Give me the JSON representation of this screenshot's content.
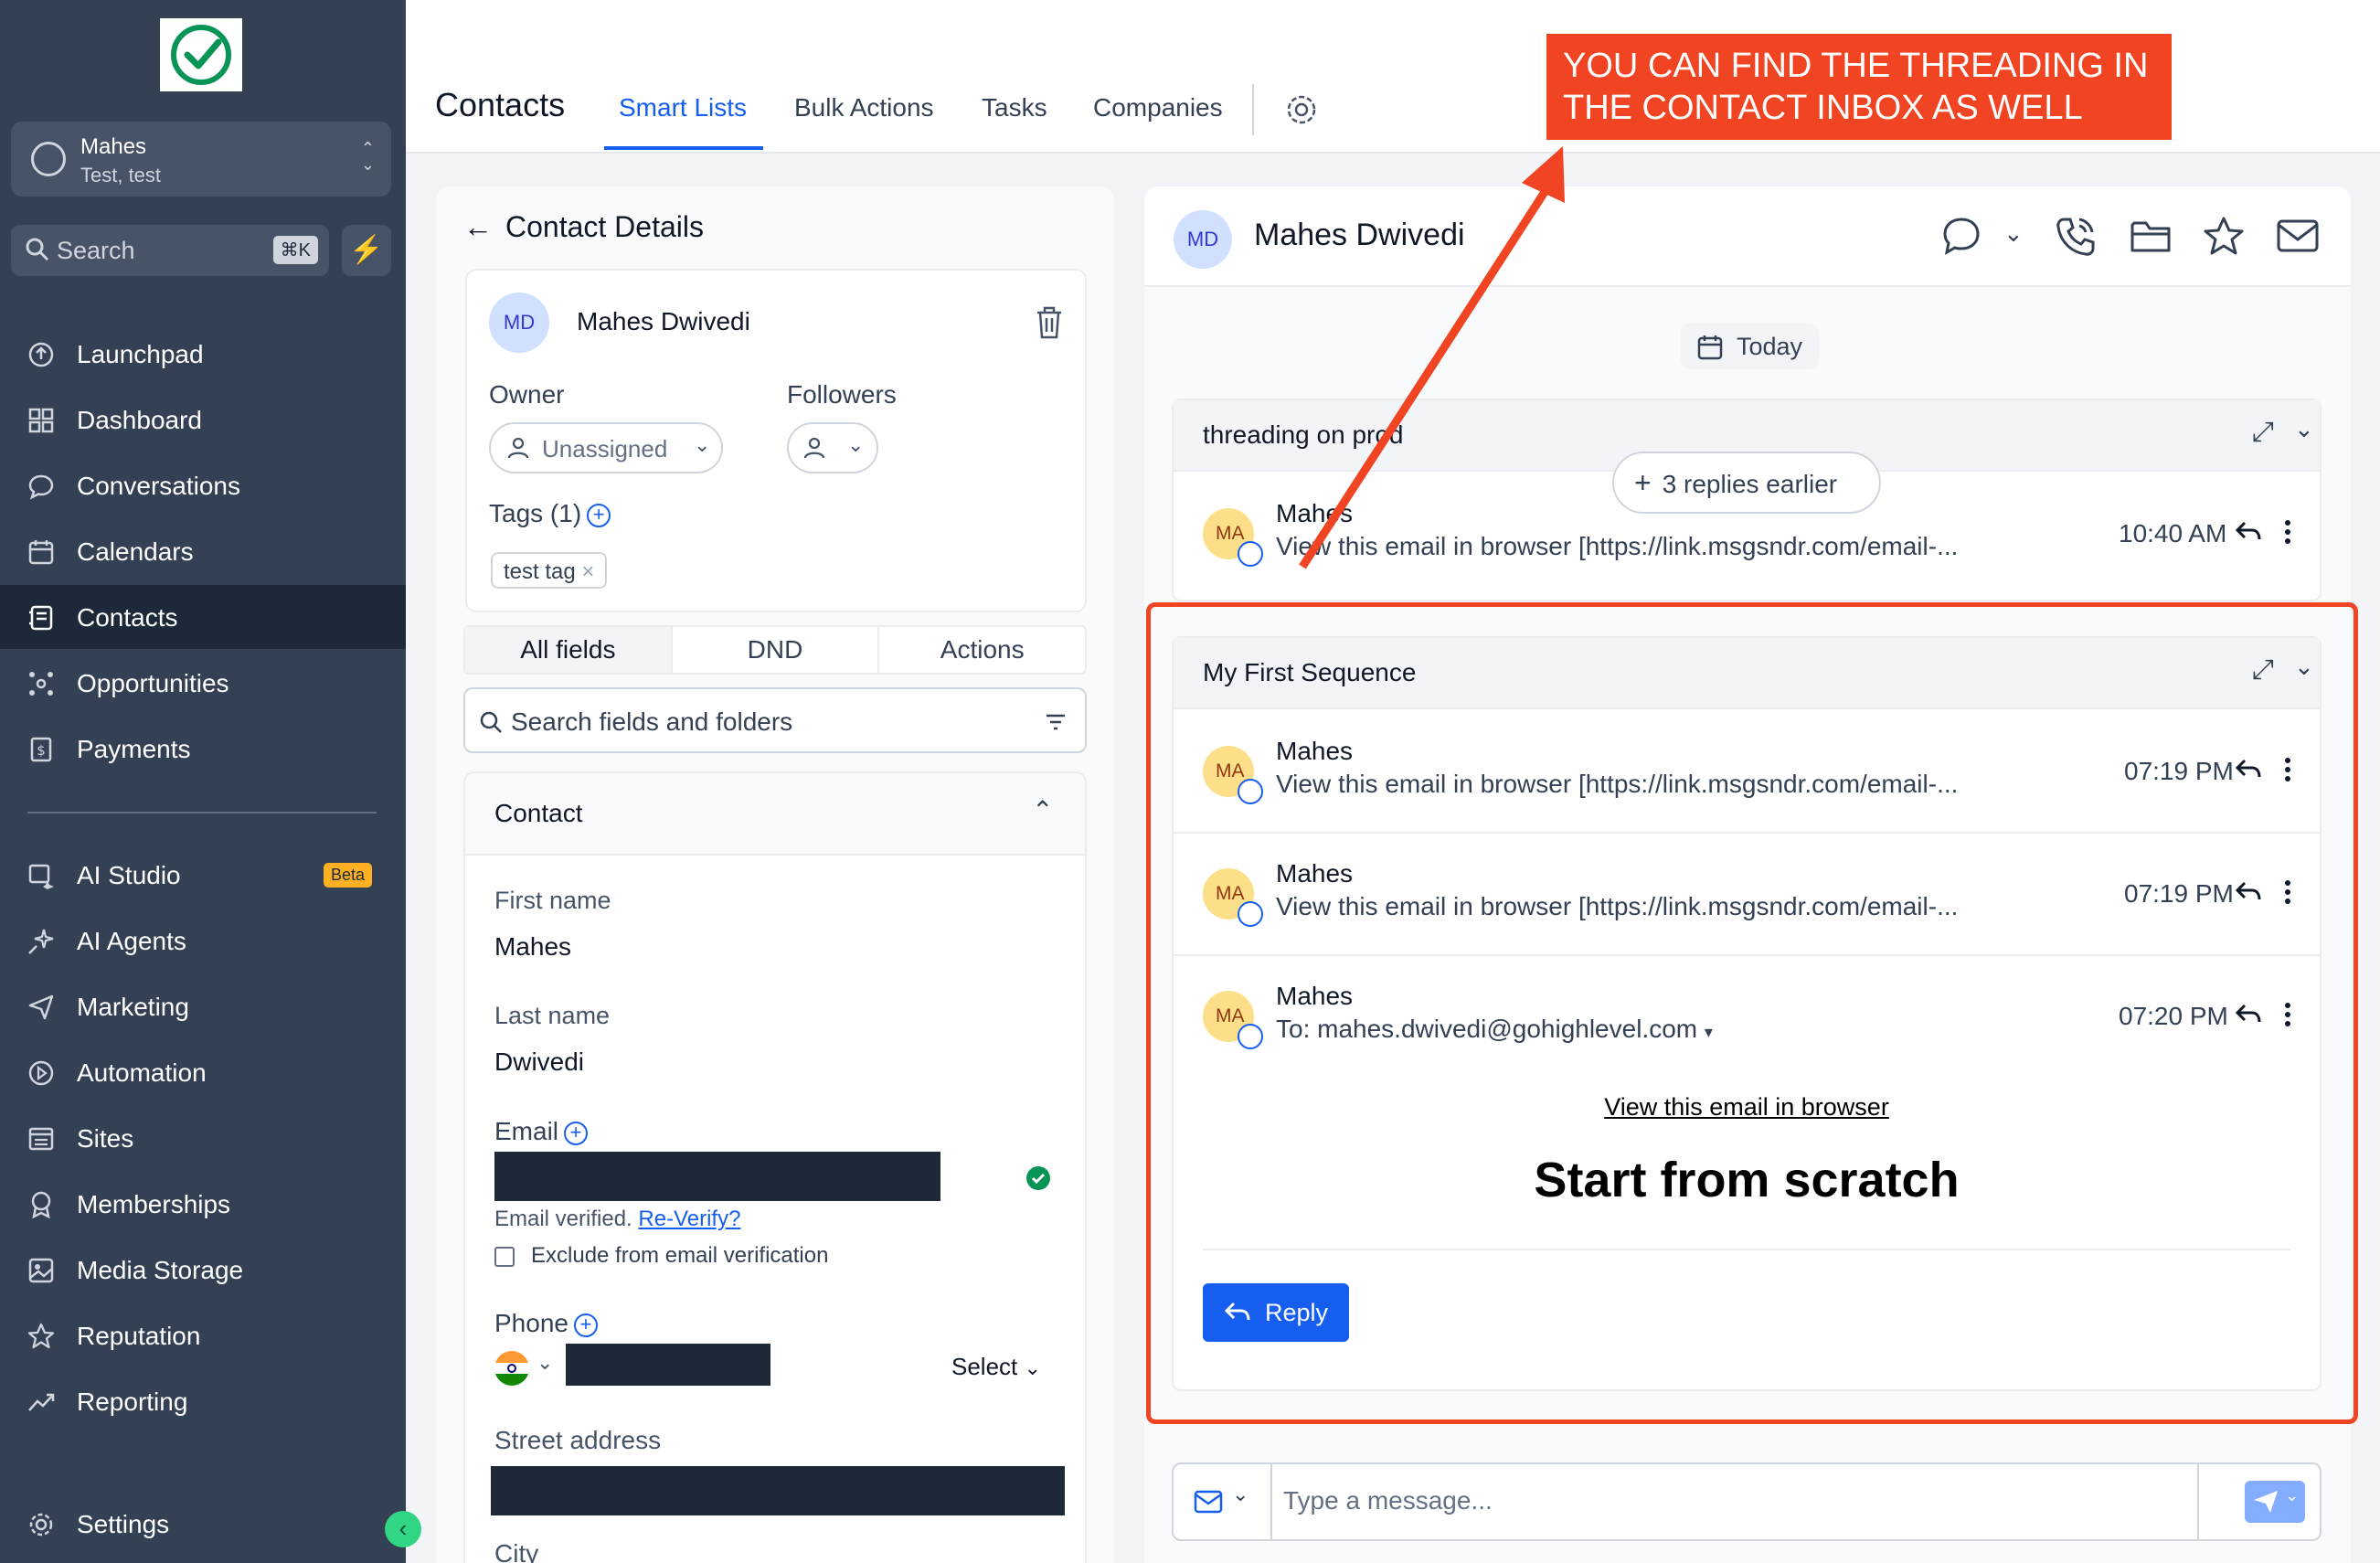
{
  "sidebar": {
    "account": {
      "name": "Mahes",
      "sub": "Test, test"
    },
    "search": {
      "placeholder": "Search",
      "shortcut": "⌘K"
    },
    "items": [
      {
        "label": "Launchpad",
        "icon": "rocket-icon"
      },
      {
        "label": "Dashboard",
        "icon": "grid-icon"
      },
      {
        "label": "Conversations",
        "icon": "chat-icon"
      },
      {
        "label": "Calendars",
        "icon": "calendar-icon"
      },
      {
        "label": "Contacts",
        "icon": "contacts-icon"
      },
      {
        "label": "Opportunities",
        "icon": "network-icon"
      },
      {
        "label": "Payments",
        "icon": "dollar-icon"
      },
      {
        "label": "AI Studio",
        "icon": "ai-studio-icon",
        "badge": "Beta"
      },
      {
        "label": "AI Agents",
        "icon": "sparkle-icon"
      },
      {
        "label": "Marketing",
        "icon": "send-icon"
      },
      {
        "label": "Automation",
        "icon": "automation-icon"
      },
      {
        "label": "Sites",
        "icon": "sites-icon"
      },
      {
        "label": "Memberships",
        "icon": "badge-icon"
      },
      {
        "label": "Media Storage",
        "icon": "image-icon"
      },
      {
        "label": "Reputation",
        "icon": "star-icon"
      },
      {
        "label": "Reporting",
        "icon": "chart-icon"
      }
    ],
    "settings_label": "Settings",
    "active_item": "Contacts"
  },
  "topbar": {
    "title": "Contacts",
    "tabs": [
      "Smart Lists",
      "Bulk Actions",
      "Tasks",
      "Companies"
    ],
    "active_tab": "Smart Lists"
  },
  "contact_details": {
    "header": "Contact Details",
    "initials": "MD",
    "name": "Mahes Dwivedi",
    "owner_label": "Owner",
    "owner_value": "Unassigned",
    "followers_label": "Followers",
    "tags_label": "Tags (1)",
    "tags": [
      "test tag"
    ],
    "segments": [
      "All fields",
      "DND",
      "Actions"
    ],
    "field_search_placeholder": "Search fields and folders",
    "section_title": "Contact",
    "first_name_label": "First name",
    "first_name": "Mahes",
    "last_name_label": "Last name",
    "last_name": "Dwivedi",
    "email_label": "Email",
    "email_verified_text": "Email verified.",
    "reverify_label": "Re-Verify?",
    "exclude_label": "Exclude from email verification",
    "phone_label": "Phone",
    "phone_type": "Select",
    "street_label": "Street address",
    "city_label": "City"
  },
  "conversation": {
    "initials": "MD",
    "name": "Mahes Dwivedi",
    "date_divider": "Today",
    "thread1": {
      "subject": "threading on prod",
      "replies_earlier": "3 replies earlier",
      "messages": [
        {
          "initials": "MA",
          "from": "Mahes",
          "preview": "View this email in browser [https://link.msgsndr.com/email-...",
          "time": "10:40 AM"
        }
      ]
    },
    "thread2": {
      "subject": "My First Sequence",
      "messages": [
        {
          "initials": "MA",
          "from": "Mahes",
          "preview": "View this email in browser [https://link.msgsndr.com/email-...",
          "time": "07:19 PM"
        },
        {
          "initials": "MA",
          "from": "Mahes",
          "preview": "View this email in browser [https://link.msgsndr.com/email-...",
          "time": "07:19 PM"
        },
        {
          "initials": "MA",
          "from": "Mahes",
          "preview": "To: mahes.dwivedi@gohighlevel.com",
          "time": "07:20 PM"
        }
      ],
      "body_link": "View this email in browser",
      "body_heading": "Start from scratch",
      "reply_label": "Reply"
    },
    "composer_placeholder": "Type a message..."
  },
  "annotation": {
    "callout": "YOU CAN FIND THE THREADING IN THE CONTACT INBOX AS WELL",
    "color": "#f04423"
  }
}
